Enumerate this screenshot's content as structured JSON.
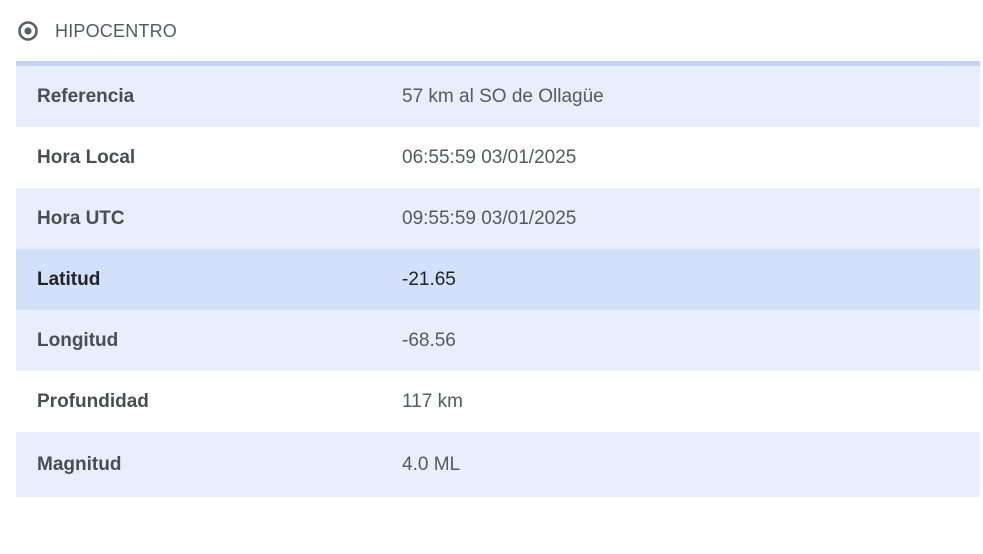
{
  "section": {
    "title": "HIPOCENTRO",
    "icon": "radio-target-icon"
  },
  "rows": [
    {
      "label": "Referencia",
      "value": "57 km al SO de Ollagüe"
    },
    {
      "label": "Hora Local",
      "value": "06:55:59 03/01/2025"
    },
    {
      "label": "Hora UTC",
      "value": "09:55:59 03/01/2025"
    },
    {
      "label": "Latitud",
      "value": "-21.65"
    },
    {
      "label": "Longitud",
      "value": "-68.56"
    },
    {
      "label": "Profundidad",
      "value": "117 km"
    },
    {
      "label": "Magnitud",
      "value": "4.0 ML"
    }
  ],
  "colors": {
    "header_border": "#c3d4f3",
    "stripe": "#e8eefb",
    "hover_row": "#d2e0fa"
  }
}
